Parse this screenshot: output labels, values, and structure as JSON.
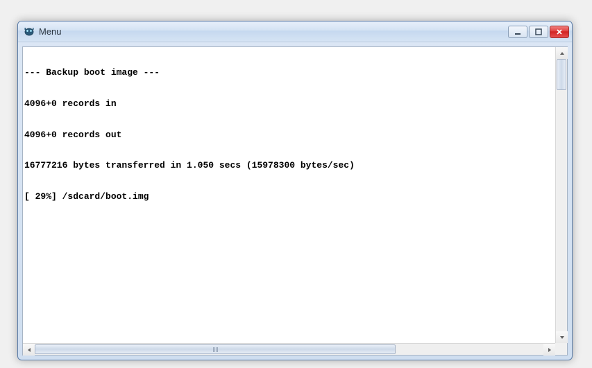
{
  "window": {
    "title": "Menu"
  },
  "terminal": {
    "lines": [
      "--- Backup boot image ---",
      "4096+0 records in",
      "4096+0 records out",
      "16777216 bytes transferred in 1.050 secs (15978300 bytes/sec)",
      "[ 29%] /sdcard/boot.img"
    ]
  }
}
